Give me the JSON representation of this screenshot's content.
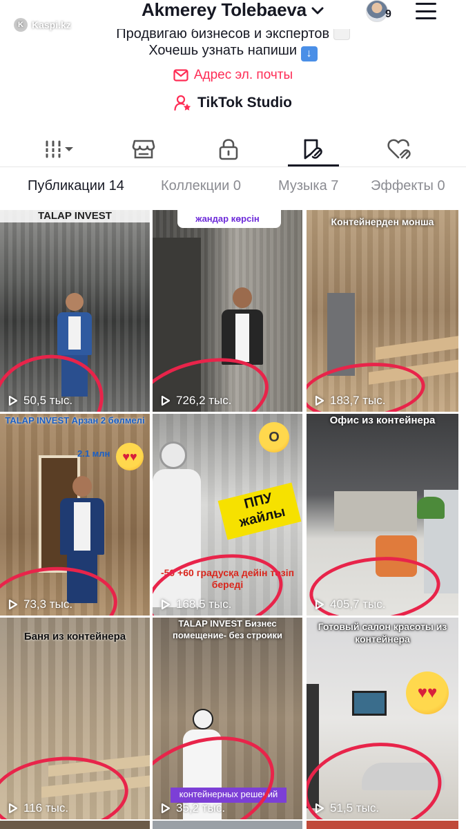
{
  "watermark": {
    "text": "Kaspi.kz",
    "logo": "K"
  },
  "profile": {
    "name": "Akmerey Tolebaeva",
    "notification_count": "9"
  },
  "bio": {
    "line1": "Продвигаю бизнесов и экспертов",
    "line2": "Хочешь узнать напиши",
    "email_label": "Адрес эл. почты",
    "studio_label": "TikTok Studio"
  },
  "icon_tabs": [
    {
      "icon": "grid-icon",
      "active": false
    },
    {
      "icon": "shop-icon",
      "active": false
    },
    {
      "icon": "lock-icon",
      "active": false
    },
    {
      "icon": "reposts-icon",
      "active": true
    },
    {
      "icon": "liked-icon",
      "active": false
    }
  ],
  "sub_tabs": [
    {
      "label": "Публикации 14",
      "active": true
    },
    {
      "label": "Коллекции 0",
      "active": false
    },
    {
      "label": "Музыка 7",
      "active": false
    },
    {
      "label": "Эффекты 0",
      "active": false
    }
  ],
  "videos": [
    {
      "caption": "TALAP INVEST",
      "views": "50,5 тыс."
    },
    {
      "caption": "жандар көрсін",
      "views": "726,2 тыс."
    },
    {
      "caption": "Контейнерден монша",
      "views": "183,7 тыс."
    },
    {
      "caption": "TALAP INVEST Арзан 2 бөлмелі",
      "caption2": "2.1 млн",
      "views": "73,3 тыс."
    },
    {
      "caption": "ППУ жайлы",
      "caption2": "-50 +60 градусқа дейін төзіп береді",
      "views": "168,5 тыс."
    },
    {
      "caption": "Офис из контейнера",
      "views": "405,7 тыс."
    },
    {
      "caption": "Баня из контейнера",
      "views": "116 тыс."
    },
    {
      "caption": "TALAP INVEST Бизнес помещение- без строики",
      "caption2": "контейнерных решений",
      "views": "35,2 тыс."
    },
    {
      "caption": "Готовый салон красоты из контейнера",
      "views": "51,5 тыс."
    }
  ],
  "colors": {
    "accent": "#fe2c55",
    "annotation": "#e8244a",
    "text": "#161823",
    "muted": "#8a8b91"
  }
}
